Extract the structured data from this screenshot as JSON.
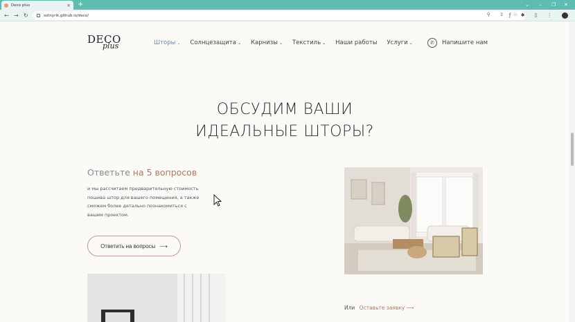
{
  "browser": {
    "tab_title": "Deco plus",
    "tab_close": "×",
    "new_tab": "+",
    "url": "sotnyrik.github.io/deco/",
    "win_minimize": "–",
    "win_restore": "❐",
    "win_close": "✕",
    "win_dropdown": "⌄",
    "back": "←",
    "forward": "→",
    "reload": "↻",
    "url_actions": "⚲ ⇪ ☆",
    "ext_actions": "ƒ ✱ ▯ ⋮"
  },
  "header": {
    "logo_top": "DECO",
    "logo_bottom": "plus",
    "nav": [
      {
        "label": "Шторы",
        "has_dropdown": true
      },
      {
        "label": "Солнцезащита",
        "has_dropdown": true
      },
      {
        "label": "Карнизы",
        "has_dropdown": true
      },
      {
        "label": "Текстиль",
        "has_dropdown": true
      },
      {
        "label": "Наши работы",
        "has_dropdown": false
      },
      {
        "label": "Услуги",
        "has_dropdown": true
      }
    ],
    "chevron": "⌄",
    "contact_label": "Напишите нам",
    "contact_icon": "whatsapp-icon"
  },
  "hero": {
    "line1": "ОБСУДИМ ВАШИ",
    "line2": "ИДЕАЛЬНЫЕ ШТОРЫ?"
  },
  "quiz": {
    "title_plain": "Ответьте",
    "title_accent": "на 5 вопросов",
    "description": "и мы рассчитаем предварительную стоимость пошива штор для вашего помещения, а также сможем более детально познакомиться с вашим проектом.",
    "button_label": "Ответить на вопросы",
    "button_arrow": "⟶"
  },
  "footer_cta": {
    "or_label": "Или",
    "link_label": "Оставьте заявку",
    "link_arrow": "⟶"
  },
  "colors": {
    "background": "#fbfaf7",
    "accent": "#a87b63",
    "browser_tab_bar": "#5cbdb0",
    "nav_active": "#6f8aa8"
  }
}
